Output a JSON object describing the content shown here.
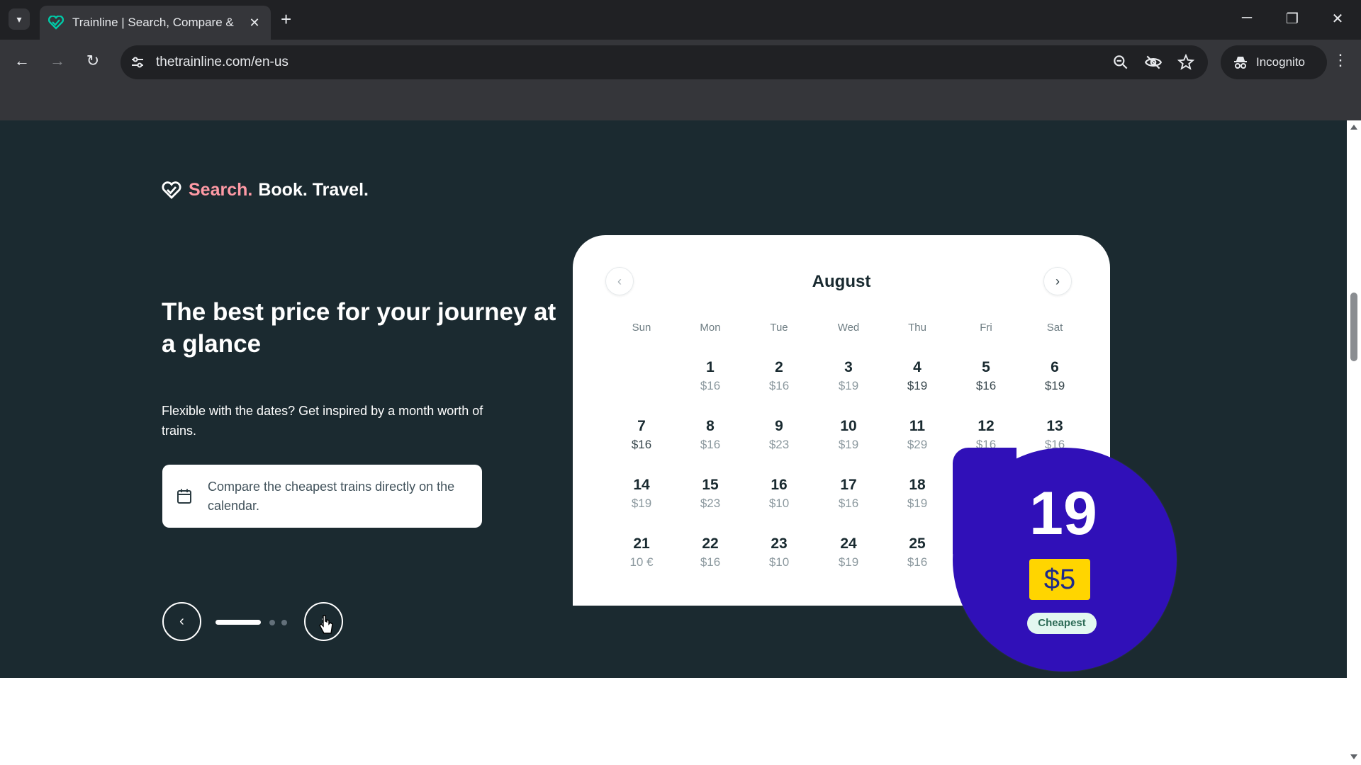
{
  "browser": {
    "tab_title": "Trainline | Search, Compare & B",
    "url": "thetrainline.com/en-us",
    "incognito_label": "Incognito"
  },
  "hero": {
    "brand": {
      "part1": "Search.",
      "part2": "Book. Travel."
    },
    "headline": "The best price for your journey at a glance",
    "subtext": "Flexible with the dates? Get inspired by a month worth of trains.",
    "card_text": "Compare the cheapest trains directly on the calendar."
  },
  "calendar": {
    "month": "August",
    "weekdays": [
      "Sun",
      "Mon",
      "Tue",
      "Wed",
      "Thu",
      "Fri",
      "Sat"
    ],
    "days": [
      {
        "day": "1",
        "price": "$16"
      },
      {
        "day": "2",
        "price": "$16"
      },
      {
        "day": "3",
        "price": "$19"
      },
      {
        "day": "4",
        "price": "$19"
      },
      {
        "day": "5",
        "price": "$16"
      },
      {
        "day": "6",
        "price": "$19"
      },
      {
        "day": "7",
        "price": "$16"
      },
      {
        "day": "8",
        "price": "$16"
      },
      {
        "day": "9",
        "price": "$23"
      },
      {
        "day": "10",
        "price": "$19"
      },
      {
        "day": "11",
        "price": "$29"
      },
      {
        "day": "12",
        "price": "$16"
      },
      {
        "day": "13",
        "price": "$16"
      },
      {
        "day": "14",
        "price": "$19"
      },
      {
        "day": "15",
        "price": "$23"
      },
      {
        "day": "16",
        "price": "$10"
      },
      {
        "day": "17",
        "price": "$16"
      },
      {
        "day": "18",
        "price": "$19"
      },
      {
        "day": "21",
        "price": "10 €"
      },
      {
        "day": "22",
        "price": "$16"
      },
      {
        "day": "23",
        "price": "$10"
      },
      {
        "day": "24",
        "price": "$19"
      },
      {
        "day": "25",
        "price": "$16"
      }
    ],
    "highlight": {
      "day": "19",
      "price": "$5",
      "tag": "Cheapest"
    }
  },
  "colors": {
    "hero_bg": "#1b2a30",
    "brand_accent": "#ff9aa5",
    "highlight_bg": "#3010b8",
    "price_badge": "#ffd500"
  },
  "icons": {
    "browser": [
      "tab-search-icon",
      "trainline-favicon-icon",
      "close-icon",
      "plus-icon",
      "minimize-icon",
      "restore-icon",
      "back-icon",
      "forward-icon",
      "reload-icon",
      "site-info-icon",
      "zoom-icon",
      "eye-off-icon",
      "star-icon",
      "incognito-icon",
      "more-icon"
    ],
    "page": [
      "trainline-logo-icon",
      "calendar-icon",
      "chevron-left-icon",
      "chevron-right-icon",
      "cursor-icon"
    ]
  }
}
